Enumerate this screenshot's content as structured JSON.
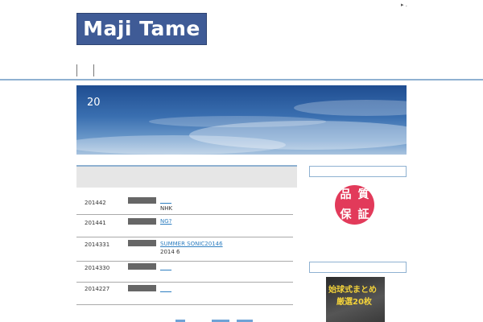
{
  "site": {
    "logo": "Maji Tame",
    "top_mark": "▸ ."
  },
  "hero": {
    "text": "20"
  },
  "posts": [
    {
      "date": "201442",
      "link": "____",
      "sub": "NHK"
    },
    {
      "date": "201441",
      "link": "NG?",
      "sub": ""
    },
    {
      "date": "2014331",
      "link": "SUMMER SONIC20146",
      "sub": "2014 6"
    },
    {
      "date": "2014330",
      "link": "____",
      "sub": ""
    },
    {
      "date": "2014227",
      "link": "____",
      "sub": ""
    }
  ],
  "sidebar": {
    "badge": [
      "品",
      "質",
      "保",
      "証"
    ],
    "promo_line1": "始球式まとめ",
    "promo_line2": "厳選20枚"
  },
  "colors": {
    "accent": "#8fb1d1",
    "logo_bg": "#3f5b96",
    "link": "#2f7fc1",
    "badge": "#e23a5a"
  }
}
